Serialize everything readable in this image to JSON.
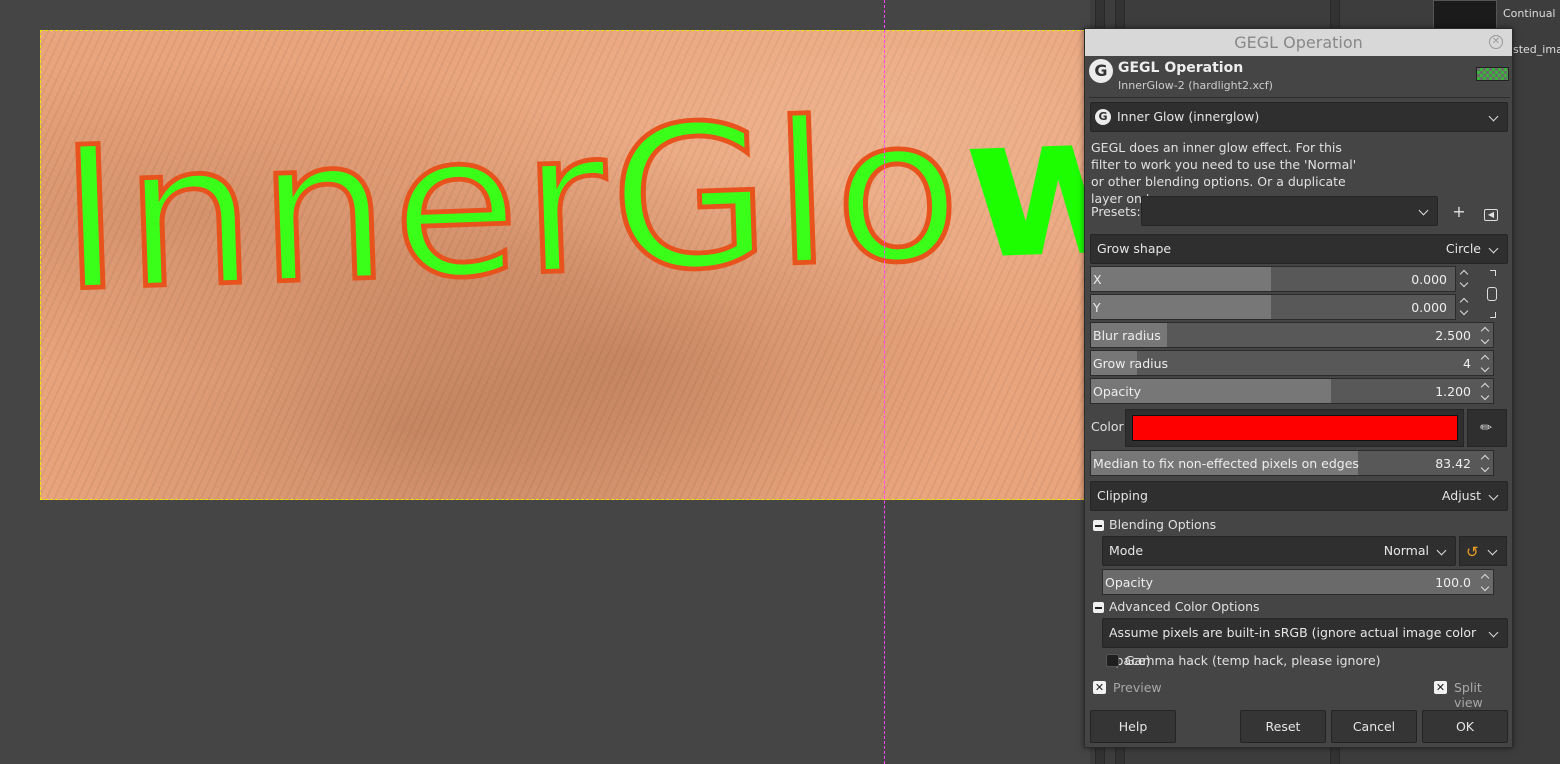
{
  "canvas": {
    "text_glow": "InnerGlo",
    "text_plain": "w"
  },
  "dock": {
    "label_continual": "Continual",
    "label_pasted": "sted_imag"
  },
  "dialog": {
    "window_title": "GEGL Operation",
    "header_title": "GEGL Operation",
    "header_subtitle": "InnerGlow-2 (hardlight2.xcf)",
    "operation_selected": "Inner Glow (innerglow)",
    "description": "GEGL does an inner glow effect. For this filter to work you need to use the 'Normal' or other blending options. Or a duplicate layer on top.",
    "presets_label": "Presets:",
    "presets_value": "",
    "grow_shape": {
      "label": "Grow shape",
      "value": "Circle"
    },
    "x": {
      "label": "X",
      "value": "0.000",
      "fill": 0.5
    },
    "y": {
      "label": "Y",
      "value": "0.000",
      "fill": 0.5
    },
    "blur_radius": {
      "label": "Blur radius",
      "value": "2.500",
      "fill": 0.19
    },
    "grow_radius": {
      "label": "Grow radius",
      "value": "4",
      "fill": 0.12
    },
    "opacity": {
      "label": "Opacity",
      "value": "1.200",
      "fill": 0.6
    },
    "color": {
      "label": "Color",
      "value": "#ff0000"
    },
    "median": {
      "label": "Median to fix non-effected pixels on edges",
      "value": "83.42",
      "fill": 0.66
    },
    "clipping": {
      "label": "Clipping",
      "value": "Adjust"
    },
    "blending": {
      "section_label": "Blending Options",
      "mode_label": "Mode",
      "mode_value": "Normal",
      "opacity_label": "Opacity",
      "opacity_value": "100.0",
      "opacity_fill": 1.0
    },
    "advanced": {
      "section_label": "Advanced Color Options",
      "color_space": "Assume pixels are built-in sRGB (ignore actual image color space)",
      "gamma_hack_label": "Gamma hack (temp hack, please ignore)",
      "gamma_hack_checked": false
    },
    "preview": {
      "label": "Preview",
      "checked": true
    },
    "split_view": {
      "label": "Split view",
      "checked": true
    },
    "buttons": {
      "help": "Help",
      "reset": "Reset",
      "cancel": "Cancel",
      "ok": "OK"
    }
  }
}
